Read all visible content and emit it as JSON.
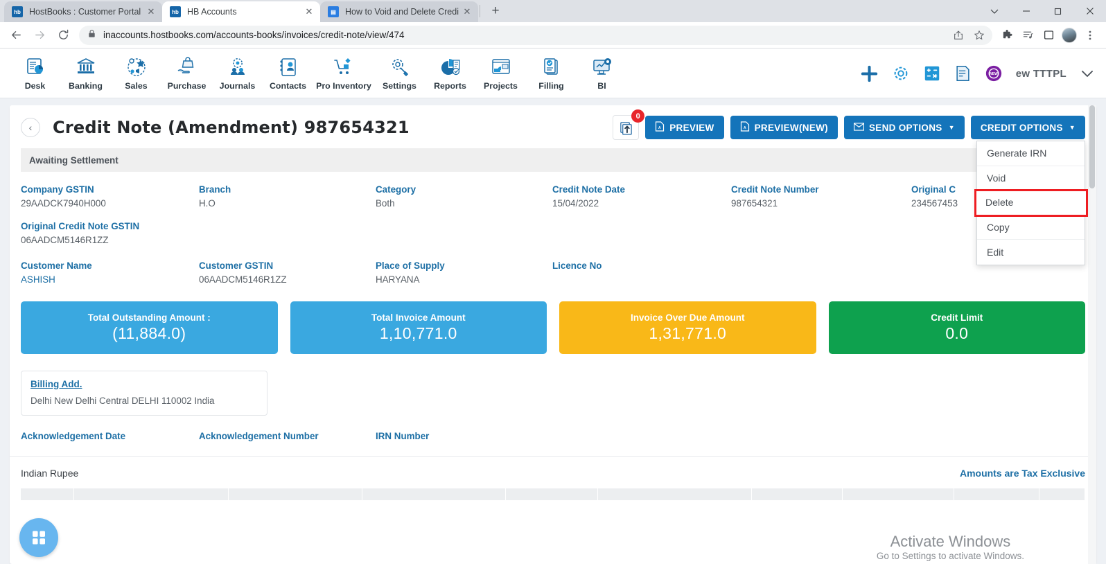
{
  "browser": {
    "tabs": [
      {
        "title": "HostBooks : Customer Portal",
        "favicon": "hb",
        "active": false
      },
      {
        "title": "HB Accounts",
        "favicon": "hb",
        "active": true
      },
      {
        "title": "How to Void and Delete Credit N",
        "favicon": "doc",
        "active": false
      }
    ],
    "new_tab_label": "+",
    "window_controls": [
      "chevron-down",
      "minimize",
      "maximize",
      "close"
    ],
    "url": "inaccounts.hostbooks.com/accounts-books/invoices/credit-note/view/474",
    "nav": {
      "back": "back-icon",
      "forward": "forward-icon",
      "reload": "reload-icon"
    },
    "toolbar_icons": [
      "share-icon",
      "bookmark-star-icon",
      "extensions-icon",
      "reading-list-icon",
      "sidebar-icon",
      "profile-avatar",
      "more-menu-icon"
    ]
  },
  "appnav": {
    "items": [
      {
        "label": "Desk",
        "icon": "desk-icon"
      },
      {
        "label": "Banking",
        "icon": "banking-icon"
      },
      {
        "label": "Sales",
        "icon": "sales-icon"
      },
      {
        "label": "Purchase",
        "icon": "purchase-icon"
      },
      {
        "label": "Journals",
        "icon": "journals-icon"
      },
      {
        "label": "Contacts",
        "icon": "contacts-icon"
      },
      {
        "label": "Pro Inventory",
        "icon": "pro-inventory-icon"
      },
      {
        "label": "Settings",
        "icon": "settings-icon"
      },
      {
        "label": "Reports",
        "icon": "reports-icon"
      },
      {
        "label": "Projects",
        "icon": "projects-icon"
      },
      {
        "label": "Filling",
        "icon": "filling-icon"
      },
      {
        "label": "BI",
        "icon": "bi-icon"
      }
    ],
    "right_icons": [
      "add-icon",
      "gear-icon",
      "calculator-icon",
      "notes-icon",
      "new-badge-icon"
    ],
    "org_name": "ew TTTPL"
  },
  "header": {
    "back": "‹",
    "title": "Credit Note (Amendment) 987654321",
    "export_badge": "0",
    "buttons": [
      {
        "label": "PREVIEW",
        "icon": "pdf-icon",
        "caret": false
      },
      {
        "label": "PREVIEW(NEW)",
        "icon": "pdf-icon",
        "caret": false
      },
      {
        "label": "SEND OPTIONS",
        "icon": "mail-icon",
        "caret": true
      },
      {
        "label": "CREDIT OPTIONS",
        "icon": "",
        "caret": true
      }
    ]
  },
  "dropdown": {
    "items": [
      {
        "label": "Generate IRN",
        "highlighted": false
      },
      {
        "label": "Void",
        "highlighted": false
      },
      {
        "label": "Delete",
        "highlighted": true
      },
      {
        "label": "Copy",
        "highlighted": false
      },
      {
        "label": "Edit",
        "highlighted": false
      }
    ],
    "highlight_color": "#ee1d22"
  },
  "status": {
    "text": "Awaiting Settlement"
  },
  "fields": {
    "row1": [
      {
        "label": "Company GSTIN",
        "value": "29AADCK7940H000"
      },
      {
        "label": "Branch",
        "value": "H.O"
      },
      {
        "label": "Category",
        "value": "Both"
      },
      {
        "label": "Credit Note Date",
        "value": "15/04/2022"
      },
      {
        "label": "Credit Note Number",
        "value": "987654321"
      },
      {
        "label": "Original C",
        "value": "234567453"
      }
    ],
    "row2": [
      {
        "label": "Original Credit Note GSTIN",
        "value": "06AADCM5146R1ZZ"
      }
    ],
    "row3": [
      {
        "label": "Customer Name",
        "value": "ASHISH"
      },
      {
        "label": "Customer GSTIN",
        "value": "06AADCM5146R1ZZ"
      },
      {
        "label": "Place of Supply",
        "value": "HARYANA"
      },
      {
        "label": "Licence No",
        "value": ""
      }
    ]
  },
  "summary_cards": [
    {
      "title": "Total Outstanding Amount :",
      "value": "(11,884.0)",
      "color": "#3aa8e0"
    },
    {
      "title": "Total Invoice Amount",
      "value": "1,10,771.0",
      "color": "#3aa8e0"
    },
    {
      "title": "Invoice Over Due Amount",
      "value": "1,31,771.0",
      "color": "#f9b818"
    },
    {
      "title": "Credit Limit",
      "value": "0.0",
      "color": "#0ea14e"
    }
  ],
  "billing": {
    "title": "Billing Add.",
    "address": "Delhi New Delhi Central DELHI 110002 India"
  },
  "acknowledgement": [
    {
      "label": "Acknowledgement Date"
    },
    {
      "label": "Acknowledgement Number"
    },
    {
      "label": "IRN Number"
    }
  ],
  "footer": {
    "currency": "Indian Rupee",
    "tax_note": "Amounts are Tax Exclusive",
    "fab_icon": "widget-grid-icon"
  },
  "watermark": {
    "line1": "Activate Windows",
    "line2": "Go to Settings to activate Windows."
  }
}
